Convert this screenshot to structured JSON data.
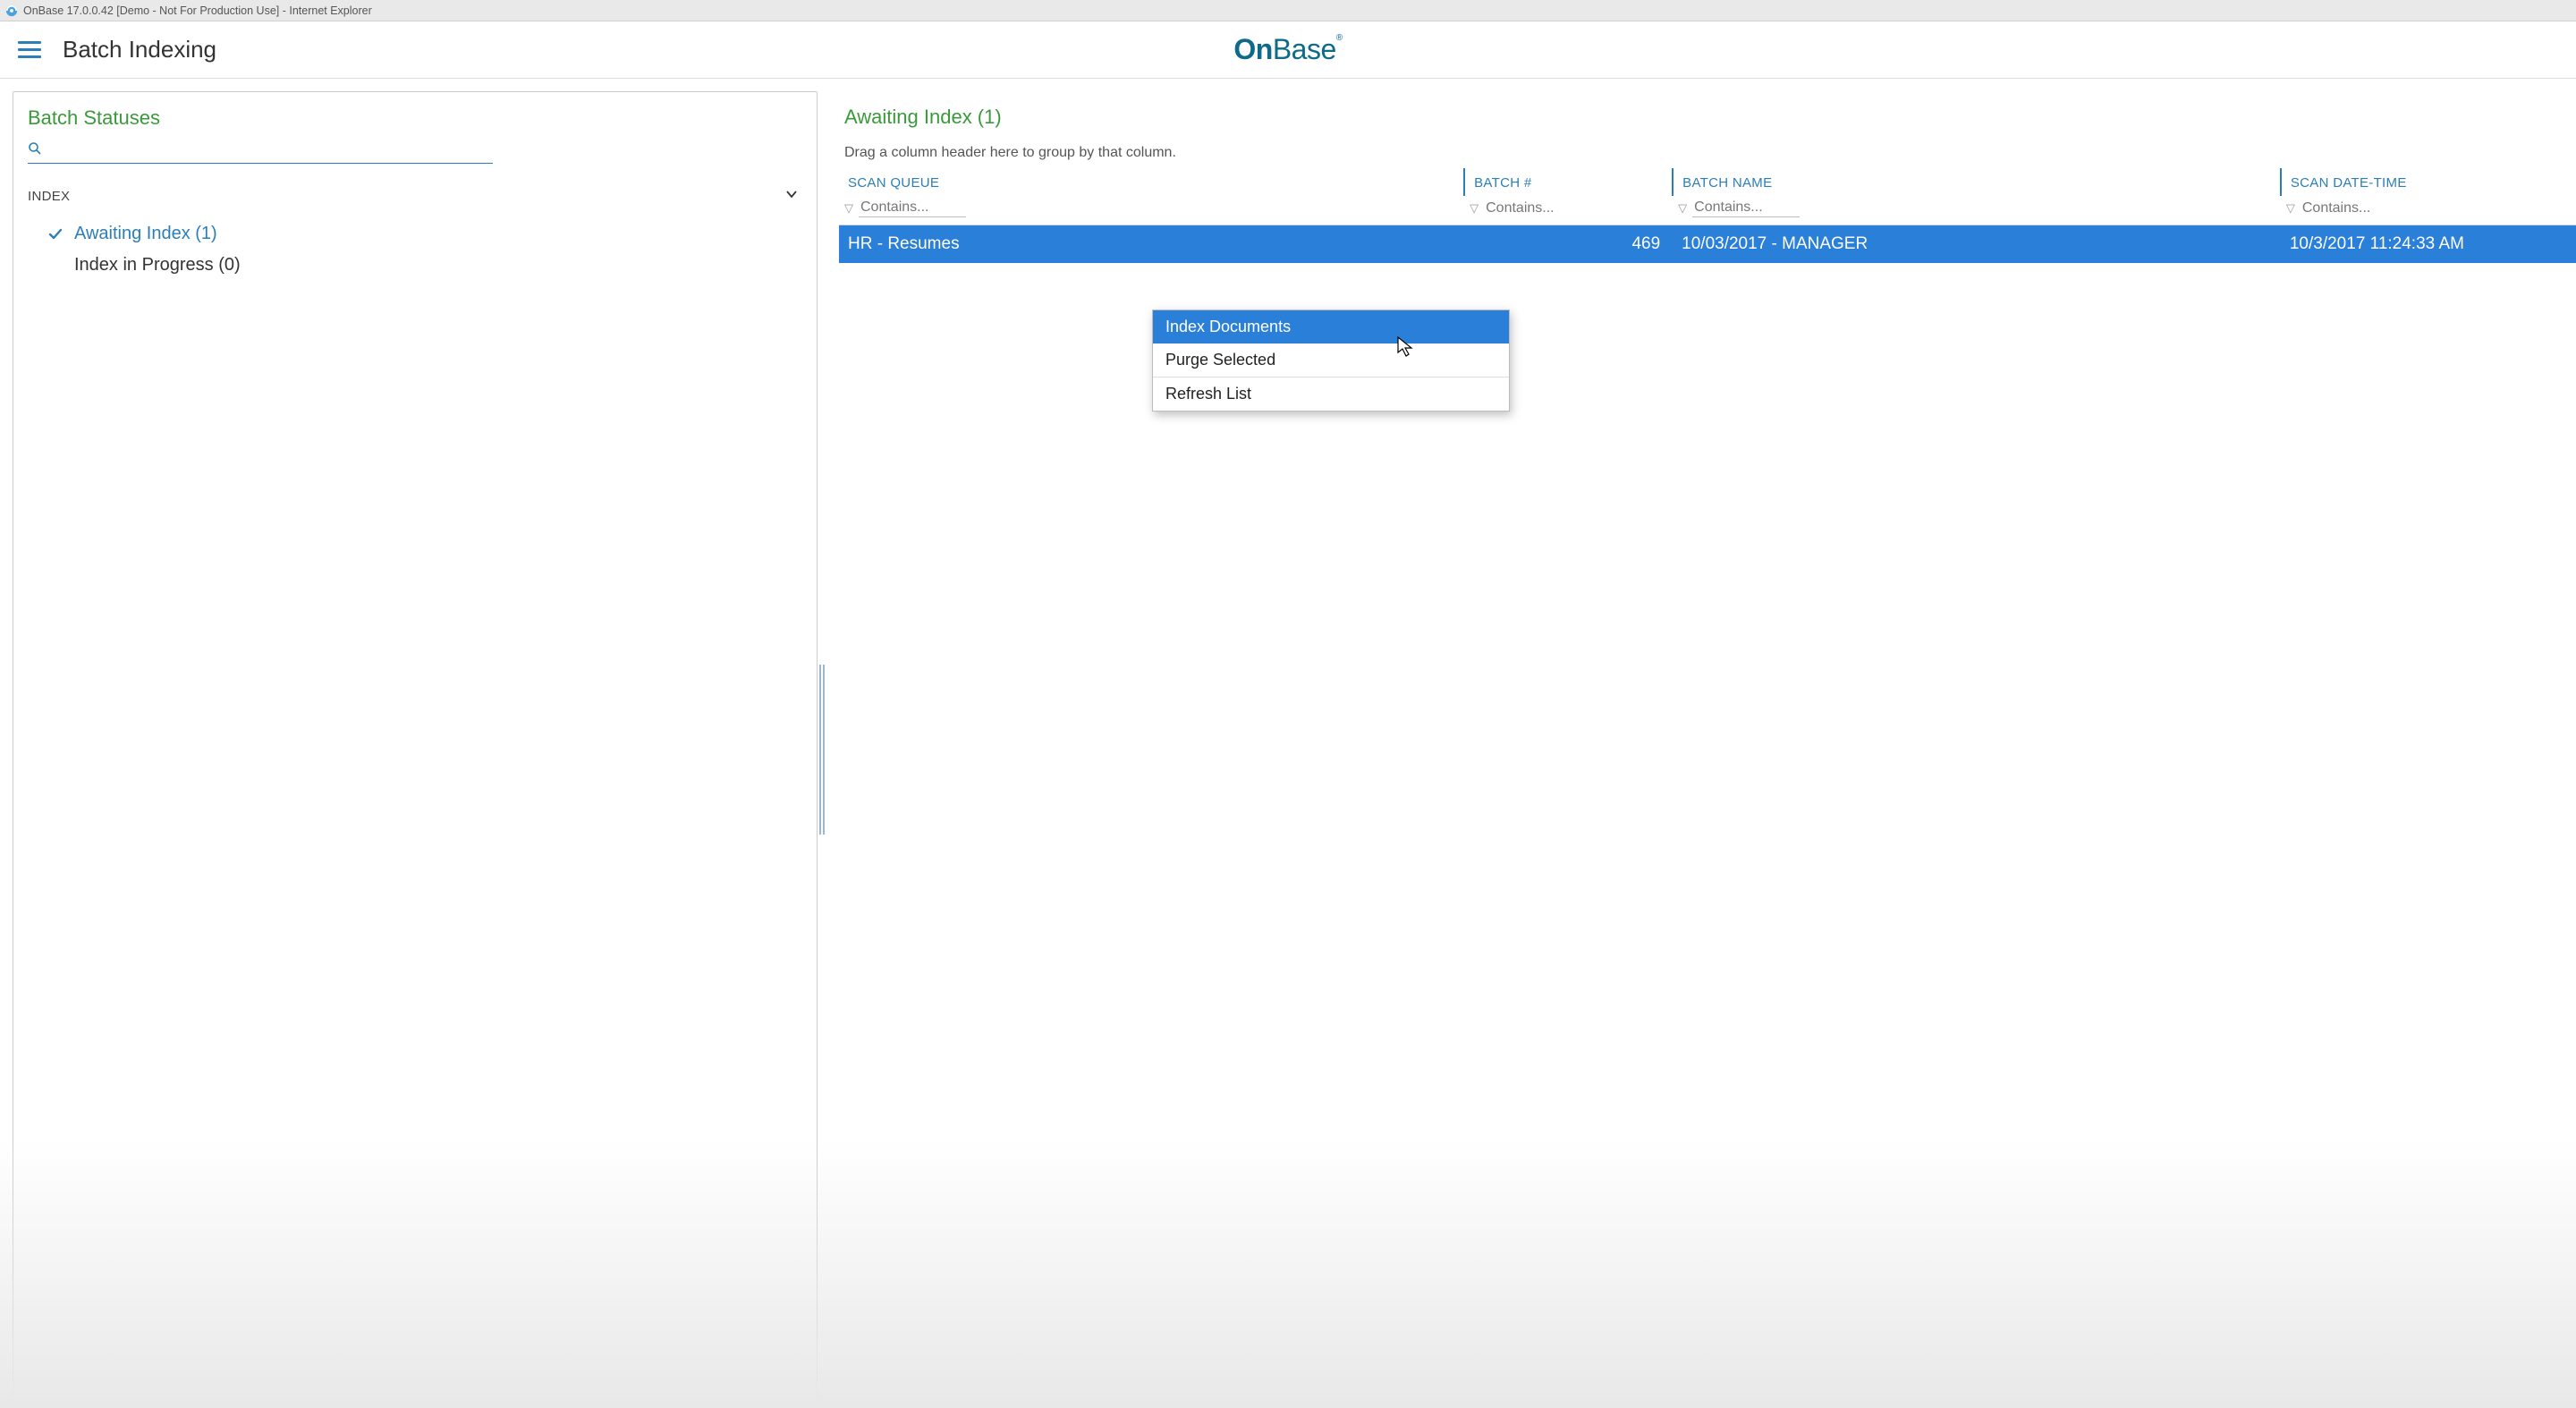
{
  "window": {
    "title": "OnBase 17.0.0.42 [Demo - Not For Production Use] - Internet Explorer"
  },
  "header": {
    "app_title": "Batch Indexing",
    "brand_on": "On",
    "brand_base": "Base"
  },
  "sidebar": {
    "title": "Batch Statuses",
    "search_placeholder": "",
    "group_label": "INDEX",
    "items": [
      {
        "label": "Awaiting Index (1)",
        "active": true
      },
      {
        "label": "Index in Progress (0)",
        "active": false
      }
    ]
  },
  "main": {
    "title": "Awaiting Index (1)",
    "group_hint": "Drag a column header here to group by that column.",
    "columns": [
      {
        "label": "SCAN QUEUE"
      },
      {
        "label": "BATCH #"
      },
      {
        "label": "BATCH NAME"
      },
      {
        "label": "SCAN DATE-TIME"
      }
    ],
    "filter_placeholder": "Contains...",
    "rows": [
      {
        "scan_queue": "HR - Resumes",
        "batch_no": "469",
        "batch_name": "10/03/2017 - MANAGER",
        "scan_dt": "10/3/2017 11:24:33 AM"
      }
    ],
    "context_menu": [
      "Index Documents",
      "Purge Selected",
      "Refresh List"
    ]
  }
}
